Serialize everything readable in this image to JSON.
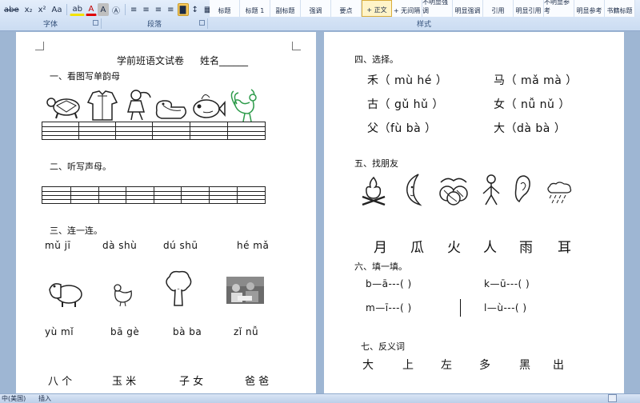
{
  "ribbon": {
    "font_buttons": [
      "abe",
      "x₂",
      "x²",
      "Aa",
      "ab",
      "A",
      "A",
      "Ⓐ"
    ],
    "para_buttons": [
      "≡",
      "≡",
      "≡",
      "≡",
      "▇",
      "↕",
      "▦",
      "⊞"
    ],
    "groups": {
      "font": "字体",
      "paragraph": "段落",
      "styles": "样式"
    },
    "styles": [
      "标题",
      "标题 1",
      "副标题",
      "强调",
      "要点",
      "+ 正文",
      "+ 无间隔",
      "不明显强调",
      "明显强调",
      "引用",
      "明显引用",
      "不明显参考",
      "明显参考",
      "书籍标题"
    ],
    "colors": {
      "accent": "#f7c95c",
      "ribbon_bg": "#d9e5f5"
    }
  },
  "left_page": {
    "title": "学前班语文试卷",
    "name_label": "姓名______",
    "section1": "一、看图写单韵母",
    "section2": "二、听写声母。",
    "section3": "三、连一连。",
    "pinyin_top": [
      "mǔ jī",
      "dà shù",
      "dú shū",
      "hé mǎ"
    ],
    "pinyin_bottom": [
      "yù mǐ",
      "bā gè",
      "bà ba",
      "zǐ nǚ"
    ],
    "words": [
      "八 个",
      "玉 米",
      "子 女",
      "爸 爸"
    ],
    "pictures_row1": [
      "turtle",
      "clothes",
      "girl",
      "goose",
      "fish",
      "rooster"
    ],
    "pictures_row2": [
      "hippo",
      "hen",
      "tree",
      "children-reading-photo"
    ]
  },
  "right_page": {
    "section4": "四、选择。",
    "choices": [
      [
        "禾（ mù    hé ）",
        "马（ mǎ   mà ）"
      ],
      [
        "古（ gǔ   hǔ  ）",
        "女（ nǚ    nǔ ）"
      ],
      [
        "父（fù    bà  ）",
        "大（dà    bà  ）"
      ]
    ],
    "section5": "五、找朋友",
    "pictures": [
      "fire",
      "moon",
      "melon",
      "person",
      "ear",
      "rain"
    ],
    "chars": [
      "月",
      "瓜",
      "火",
      "人",
      "雨",
      "耳"
    ],
    "section6": "六、填一填。",
    "fill": [
      "b—ā---(     )",
      "k—ū---(     )",
      "m—ī---(     )",
      "l—ù---(     )"
    ],
    "section7": "七、反义词",
    "antonyms": [
      "大",
      "上",
      "左",
      "多",
      "黑",
      "出"
    ]
  },
  "status": {
    "lang": "中(美国)",
    "mode": "插入"
  }
}
